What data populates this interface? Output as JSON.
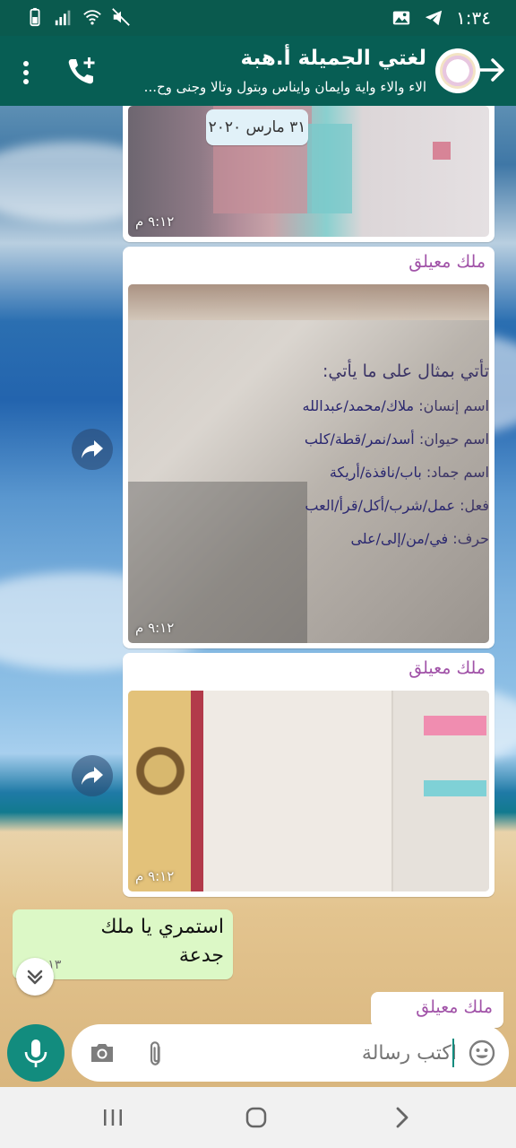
{
  "status_bar": {
    "time": "١:٣٤"
  },
  "header": {
    "title": "لغتي الجميلة أ.هبة",
    "subtitle": "الاء والاء واية وايمان وايناس وبتول وتالا وجنى وح..."
  },
  "messages": {
    "date_chip": "٣١ مارس ٢٠٢٠",
    "msg1": {
      "time": "٩:١٢ م"
    },
    "msg2": {
      "sender": "ملك معيلق",
      "time": "٩:١٢ م"
    },
    "msg3": {
      "sender": "ملك معيلق",
      "time": "٩:١٢ م"
    },
    "outgoing": {
      "text": "استمري يا ملك جدعة",
      "time": "٩:١٣ م"
    },
    "msg5": {
      "sender": "ملك معيلق"
    }
  },
  "worksheet": {
    "heading": "تأتي بمثال على ما يأتي:",
    "rows": [
      {
        "label": "اسم إنسان:",
        "answer": "ملاك/محمد/عبدالله"
      },
      {
        "label": "اسم حيوان:",
        "answer": "أسد/نمر/قطة/كلب"
      },
      {
        "label": "اسم جماد:",
        "answer": "باب/نافذة/أريكة"
      },
      {
        "label": "فعل:",
        "answer": "عمل/شرب/أكل/قرأ/العب"
      },
      {
        "label": "حرف:",
        "answer": "في/من/إلى/على"
      }
    ]
  },
  "composer": {
    "placeholder": "اكتب رسالة"
  },
  "colors": {
    "header": "#075e54",
    "accent": "#128c7e",
    "sender_name": "#a153a8",
    "outgoing_bubble": "#dcf8c6"
  },
  "icons": [
    "back-arrow-icon",
    "call-add-icon",
    "menu-icon",
    "forward-icon",
    "chevron-down-icon",
    "mic-icon",
    "camera-icon",
    "attach-icon",
    "emoji-icon",
    "nav-recents-icon",
    "nav-home-icon",
    "nav-back-icon"
  ]
}
